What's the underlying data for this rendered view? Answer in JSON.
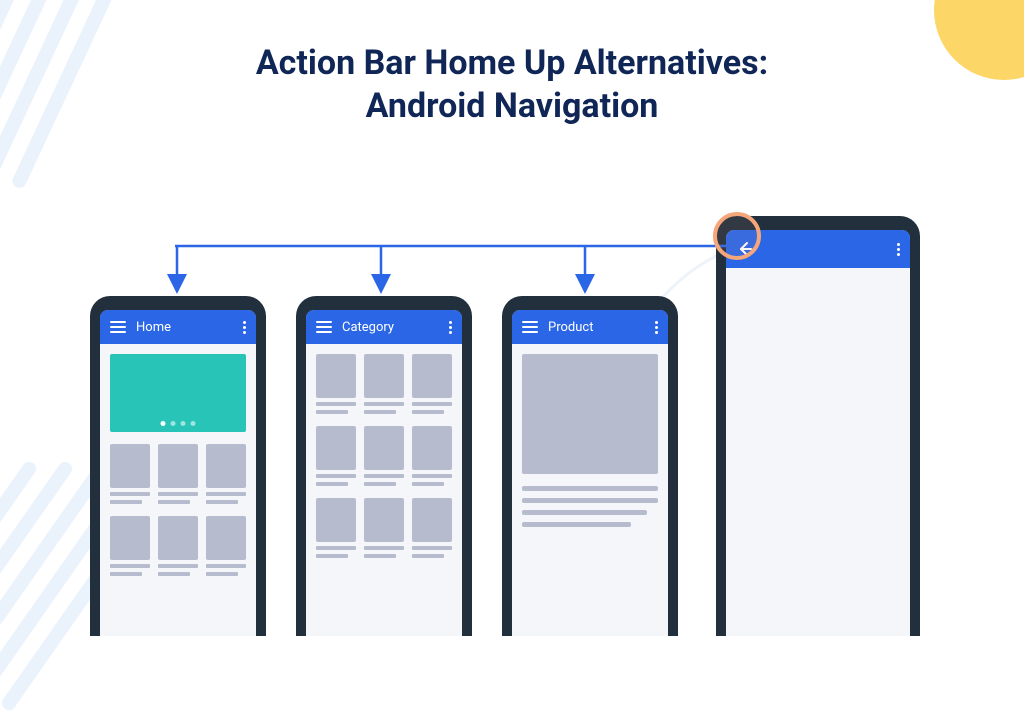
{
  "title_line1": "Action Bar Home Up Alternatives:",
  "title_line2": "Android Navigation",
  "colors": {
    "title": "#0f2656",
    "appbar": "#2b66e6",
    "arrow": "#2b66e6",
    "accent_teal": "#28c4b8",
    "placeholder": "#b6bccd",
    "phone_body": "#22303e",
    "highlight": "#f5a67a",
    "bg_yellow": "#fcd667"
  },
  "phones": [
    {
      "id": "home",
      "appbar_title": "Home",
      "left_icon": "hamburger"
    },
    {
      "id": "category",
      "appbar_title": "Category",
      "left_icon": "hamburger"
    },
    {
      "id": "product",
      "appbar_title": "Product",
      "left_icon": "hamburger"
    },
    {
      "id": "detail",
      "appbar_title": "",
      "left_icon": "back-arrow"
    }
  ],
  "highlight_target": "back-arrow-icon"
}
